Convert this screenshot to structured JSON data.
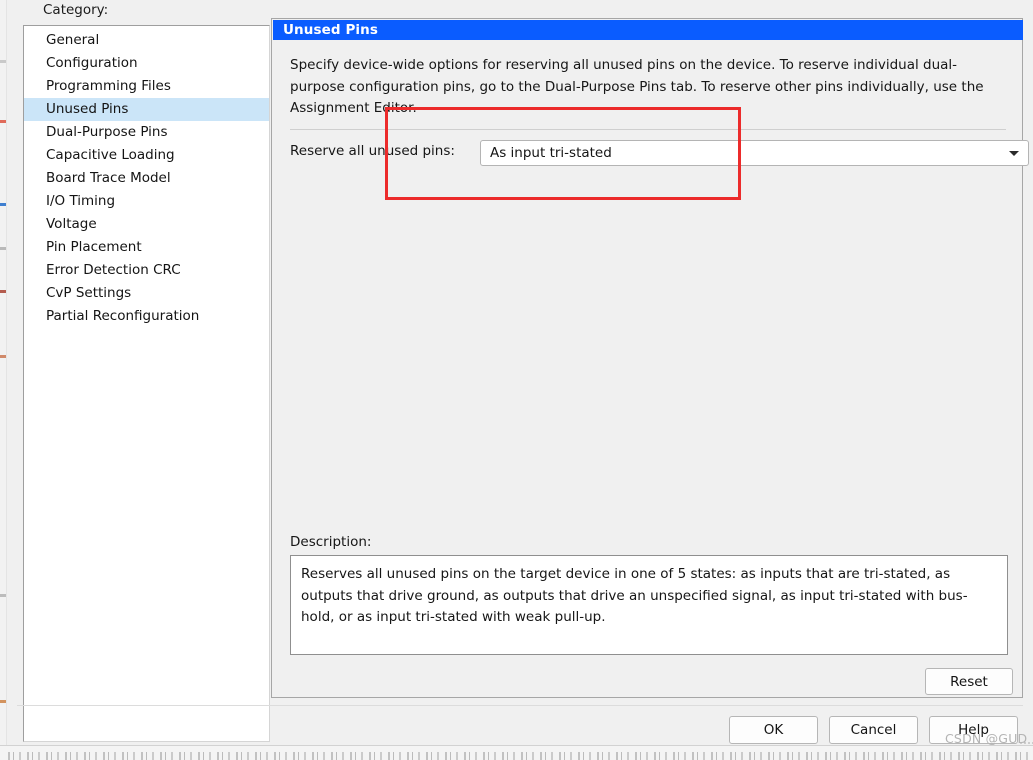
{
  "colors": {
    "panel_title_bg": "#0a5cff",
    "panel_title_fg": "#ffffff",
    "list_selection_bg": "#cbe5f8",
    "annotation_red": "#ec2b2b",
    "dialog_bg": "#f0f0f0",
    "field_bg": "#ffffff"
  },
  "category": {
    "label": "Category:",
    "items": [
      {
        "label": "General",
        "selected": false
      },
      {
        "label": "Configuration",
        "selected": false
      },
      {
        "label": "Programming Files",
        "selected": false
      },
      {
        "label": "Unused Pins",
        "selected": true
      },
      {
        "label": "Dual-Purpose Pins",
        "selected": false
      },
      {
        "label": "Capacitive Loading",
        "selected": false
      },
      {
        "label": "Board Trace Model",
        "selected": false
      },
      {
        "label": "I/O Timing",
        "selected": false
      },
      {
        "label": "Voltage",
        "selected": false
      },
      {
        "label": "Pin Placement",
        "selected": false
      },
      {
        "label": "Error Detection CRC",
        "selected": false
      },
      {
        "label": "CvP Settings",
        "selected": false
      },
      {
        "label": "Partial Reconfiguration",
        "selected": false
      }
    ]
  },
  "panel": {
    "title": "Unused Pins",
    "intro": "Specify device-wide options for reserving all unused pins on the device. To reserve individual dual-purpose configuration pins, go to the Dual-Purpose Pins tab. To reserve other pins individually, use the Assignment Editor.",
    "field": {
      "label": "Reserve all unused pins:",
      "value": "As input tri-stated",
      "dropdown_icon": "chevron-down-icon"
    },
    "description": {
      "label": "Description:",
      "text": "Reserves all unused pins on the target device in one of 5 states: as inputs that are tri-stated, as outputs that drive ground, as outputs that drive an unspecified signal, as input tri-stated with bus-hold, or as input tri-stated with weak pull-up."
    },
    "reset_label": "Reset"
  },
  "footer": {
    "ok_label": "OK",
    "cancel_label": "Cancel",
    "help_label": "Help"
  },
  "watermark": {
    "text": "CSDN @GUD"
  }
}
